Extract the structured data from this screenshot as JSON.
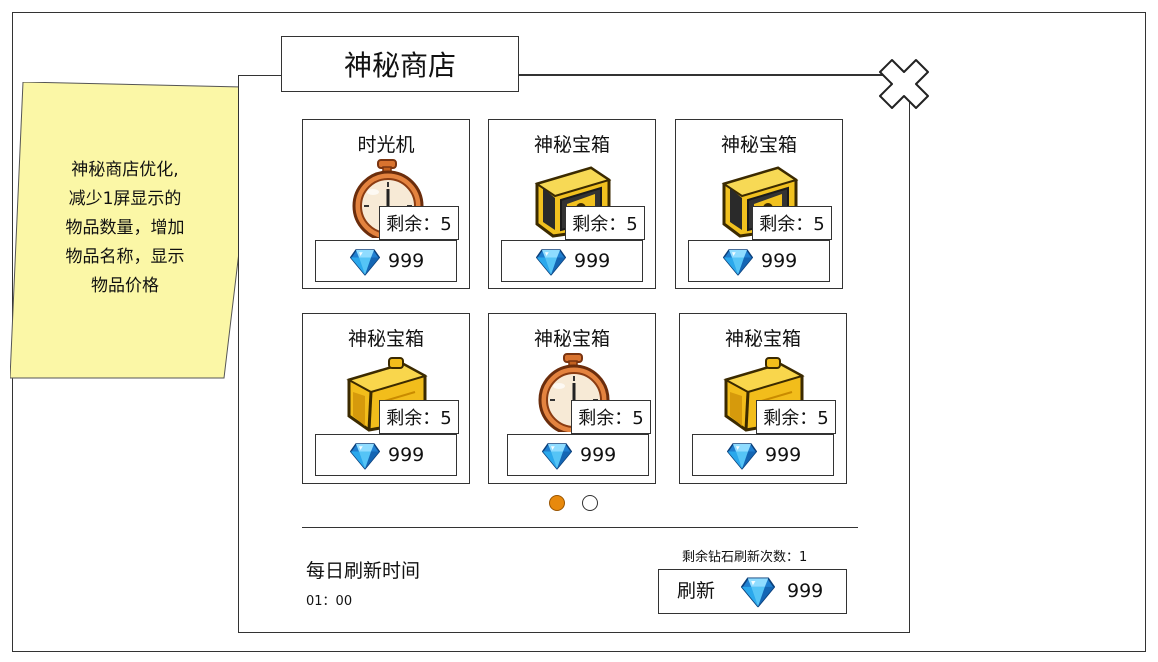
{
  "window": {
    "title": "神秘商店"
  },
  "note": {
    "lines": [
      "神秘商店优化,",
      "减少1屏显示的",
      "物品数量，增加",
      "物品名称，显示",
      "物品价格"
    ]
  },
  "items": [
    {
      "name": "时光机",
      "icon": "pocket-watch-icon",
      "remaining": "剩余：5",
      "price": "999"
    },
    {
      "name": "神秘宝箱",
      "icon": "mystery-chest-icon",
      "remaining": "剩余：5",
      "price": "999"
    },
    {
      "name": "神秘宝箱",
      "icon": "mystery-chest-icon",
      "remaining": "剩余：5",
      "price": "999"
    },
    {
      "name": "神秘宝箱",
      "icon": "treasure-chest-icon",
      "remaining": "剩余：5",
      "price": "999"
    },
    {
      "name": "神秘宝箱",
      "icon": "pocket-watch-icon",
      "remaining": "剩余：5",
      "price": "999"
    },
    {
      "name": "神秘宝箱",
      "icon": "treasure-chest-icon",
      "remaining": "剩余：5",
      "price": "999"
    }
  ],
  "pagination": {
    "pages": 2,
    "current": 1,
    "active_color": "#e8890c"
  },
  "footer": {
    "daily_refresh_label": "每日刷新时间",
    "daily_refresh_time": "01：00",
    "remaining_refresh_text": "剩余钻石刷新次数：1",
    "refresh_label": "刷新",
    "refresh_price": "999"
  },
  "colors": {
    "note_fill": "#fbf7a6",
    "diamond": "#29a9e8",
    "gold": "#f1c11f",
    "watch": "#e07a3d"
  }
}
